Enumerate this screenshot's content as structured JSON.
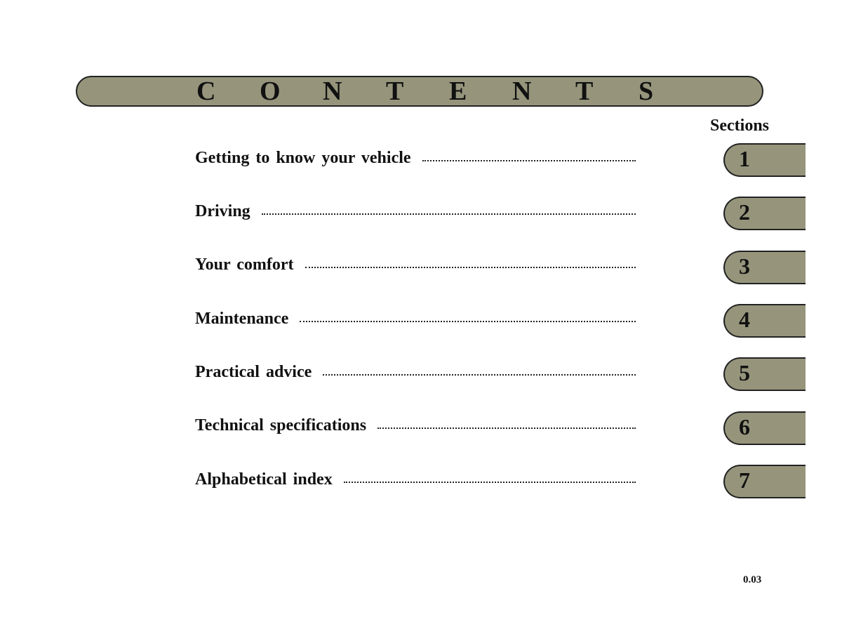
{
  "header": {
    "title_letters": [
      "C",
      "O",
      "N",
      "T",
      "E",
      "N",
      "T",
      "S"
    ]
  },
  "sections_label": "Sections",
  "toc": [
    {
      "title": "Getting to know your vehicle",
      "section": "1"
    },
    {
      "title": "Driving",
      "section": "2"
    },
    {
      "title": "Your comfort",
      "section": "3"
    },
    {
      "title": "Maintenance",
      "section": "4"
    },
    {
      "title": "Practical advice",
      "section": "5"
    },
    {
      "title": "Technical specifications",
      "section": "6"
    },
    {
      "title": "Alphabetical index",
      "section": "7"
    }
  ],
  "colors": {
    "tab_fill": "#96957c",
    "outline": "#222222"
  },
  "page_number": "0.03"
}
